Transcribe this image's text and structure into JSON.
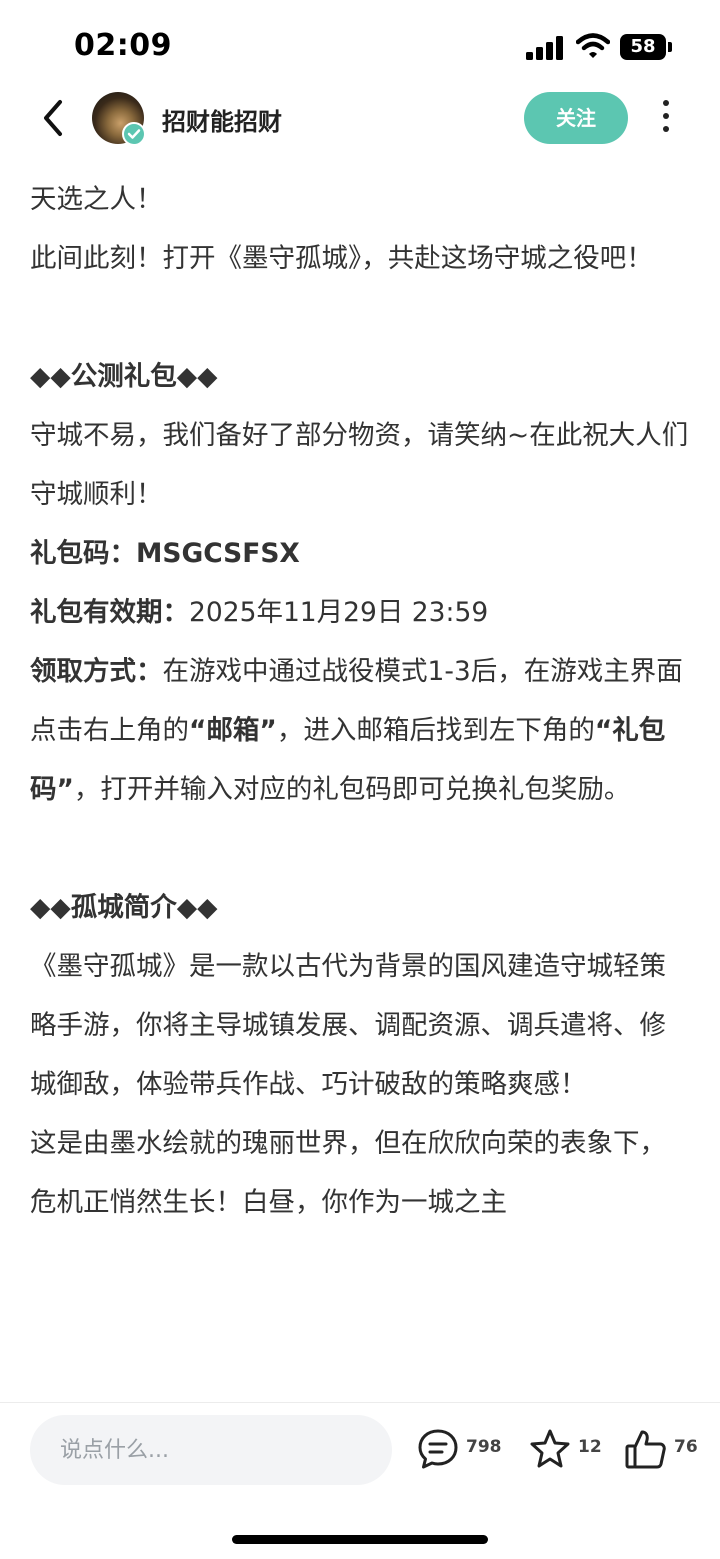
{
  "status_bar": {
    "time": "02:09",
    "battery": "58"
  },
  "header": {
    "author": "招财能招财",
    "follow_label": "关注"
  },
  "content": {
    "intro": [
      "天选之人！",
      "此间此刻！打开《墨守孤城》，共赴这场守城之役吧！"
    ],
    "gift_section": {
      "title": "◆◆公测礼包◆◆",
      "desc": "守城不易，我们备好了部分物资，请笑纳~在此祝大人们守城顺利！",
      "code_label": "礼包码：",
      "code_value": "MSGCSFSX",
      "expiry_label": "礼包有效期：",
      "expiry_value": "2025年11月29日 23:59",
      "method_label": "领取方式：",
      "method_part1": "在游戏中通过战役模式1-3后，在游戏主界面点击右上角的",
      "method_mailbox": "“邮箱”",
      "method_part2": "，进入邮箱后找到左下角的",
      "method_giftcode": "“礼包码”",
      "method_part3": "，打开并输入对应的礼包码即可兑换礼包奖励。"
    },
    "intro_section": {
      "title": "◆◆孤城简介◆◆",
      "para1": "《墨守孤城》是一款以古代为背景的国风建造守城轻策略手游，你将主导城镇发展、调配资源、调兵遣将、修城御敌，体验带兵作战、巧计破敌的策略爽感！",
      "para2": "这是由墨水绘就的瑰丽世界，但在欣欣向荣的表象下，危机正悄然生长！白昼，你作为一城之主"
    }
  },
  "bottom_bar": {
    "comment_placeholder": "说点什么...",
    "comments_count": "798",
    "favorites_count": "12",
    "likes_count": "76"
  },
  "icons": [
    "back-icon",
    "verified-icon",
    "more-icon",
    "signal-icon",
    "wifi-icon",
    "battery-icon",
    "comment-icon",
    "star-icon",
    "thumbs-up-icon"
  ],
  "colors": {
    "accent": "#5cc6b1",
    "text": "#333333",
    "input_bg": "#f3f4f6"
  }
}
